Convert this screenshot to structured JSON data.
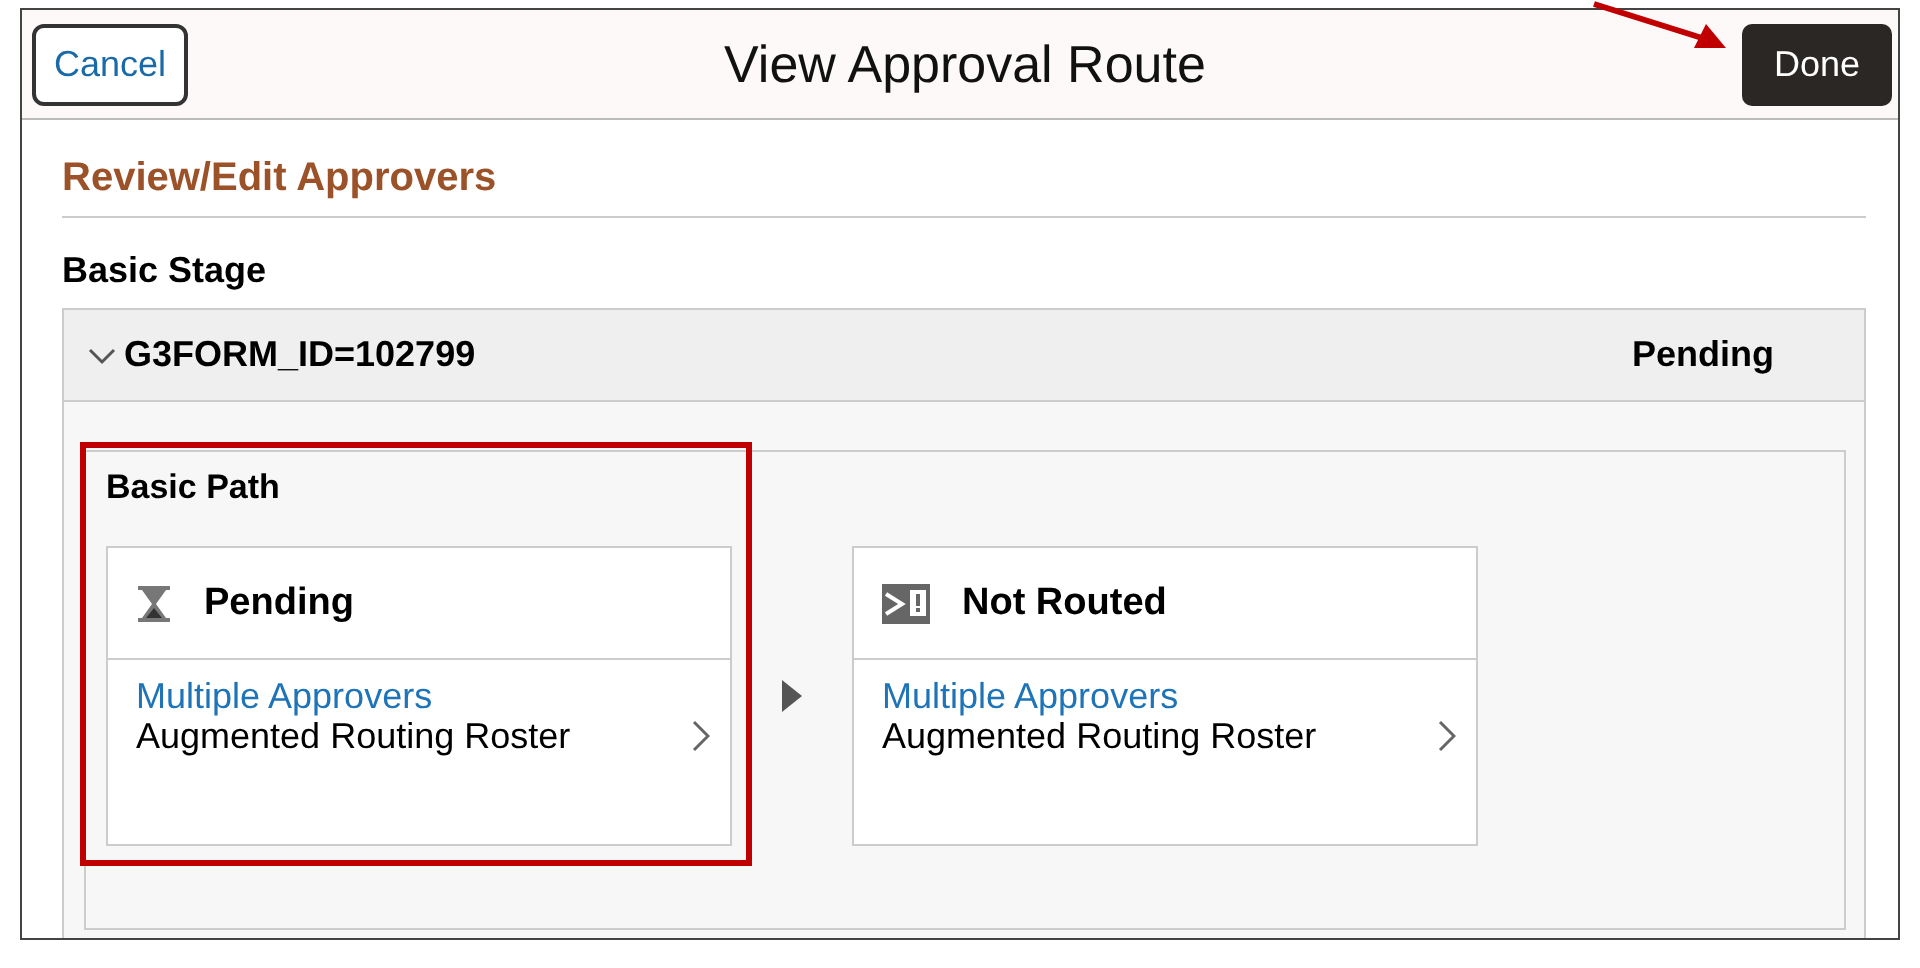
{
  "header": {
    "cancel": "Cancel",
    "title": "View Approval Route",
    "done": "Done"
  },
  "annotations": {
    "callout_arrow": true,
    "highlight_frame": true
  },
  "section_title": "Review/Edit Approvers",
  "stage": {
    "label": "Basic Stage",
    "name": "G3FORM_ID=102799",
    "status": "Pending",
    "expanded": true,
    "path": {
      "label": "Basic Path",
      "steps": [
        {
          "kind": "pending",
          "status": "Pending",
          "approver": "Multiple Approvers",
          "roster": "Augmented Routing Roster"
        },
        {
          "kind": "not_routed",
          "status": "Not Routed",
          "approver": "Multiple Approvers",
          "roster": "Augmented Routing Roster"
        }
      ]
    }
  }
}
